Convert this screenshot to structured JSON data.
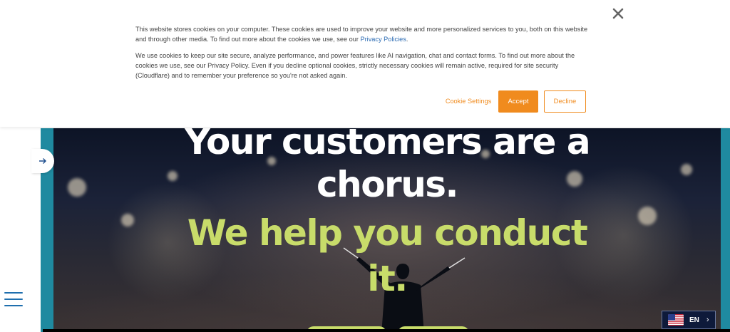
{
  "cookie_banner": {
    "paragraph1": "This website stores cookies on your computer. These cookies are used to improve your website and more personalized services to you, both on this website and through other media. To find out more about the cookies we use, see our ",
    "paragraph1_link": "Privacy Policies",
    "paragraph1_end": ".",
    "paragraph2": "We use cookies to keep our site secure, analyze performance, and power features like AI navigation, chat and contact forms. To find out more about the cookies we use, see our Privacy Policy. Even if you decline optional cookies, strictly necessary cookies will remain active, required for site security (Cloudflare) and to remember your preference so you're not asked again.",
    "settings_label": "Cookie Settings",
    "accept_label": "Accept",
    "decline_label": "Decline",
    "accent_color": "#f08b1e"
  },
  "hero": {
    "line1": "Your customers are a",
    "line2": "chorus.",
    "line3": "We help you conduct",
    "line4": "it.",
    "headline_color": "#ffffff",
    "accent_color": "#c8dc6a"
  },
  "language": {
    "code": "EN",
    "flag_icon": "us-flag-icon"
  },
  "icons": {
    "close": "close-icon",
    "arrow": "arrow-right-icon",
    "menu": "hamburger-menu-icon"
  },
  "brand": {
    "teal": "#1f8aa0",
    "navy": "#0e1a3a"
  }
}
